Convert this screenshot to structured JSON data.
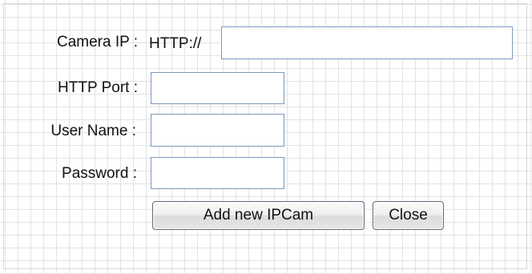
{
  "form": {
    "camera_ip": {
      "label": "Camera IP :",
      "prefix": "HTTP://",
      "value": ""
    },
    "http_port": {
      "label": "HTTP Port :",
      "value": ""
    },
    "user_name": {
      "label": "User Name :",
      "value": ""
    },
    "password": {
      "label": "Password :",
      "value": ""
    }
  },
  "buttons": {
    "add_label": "Add new IPCam",
    "close_label": "Close"
  }
}
